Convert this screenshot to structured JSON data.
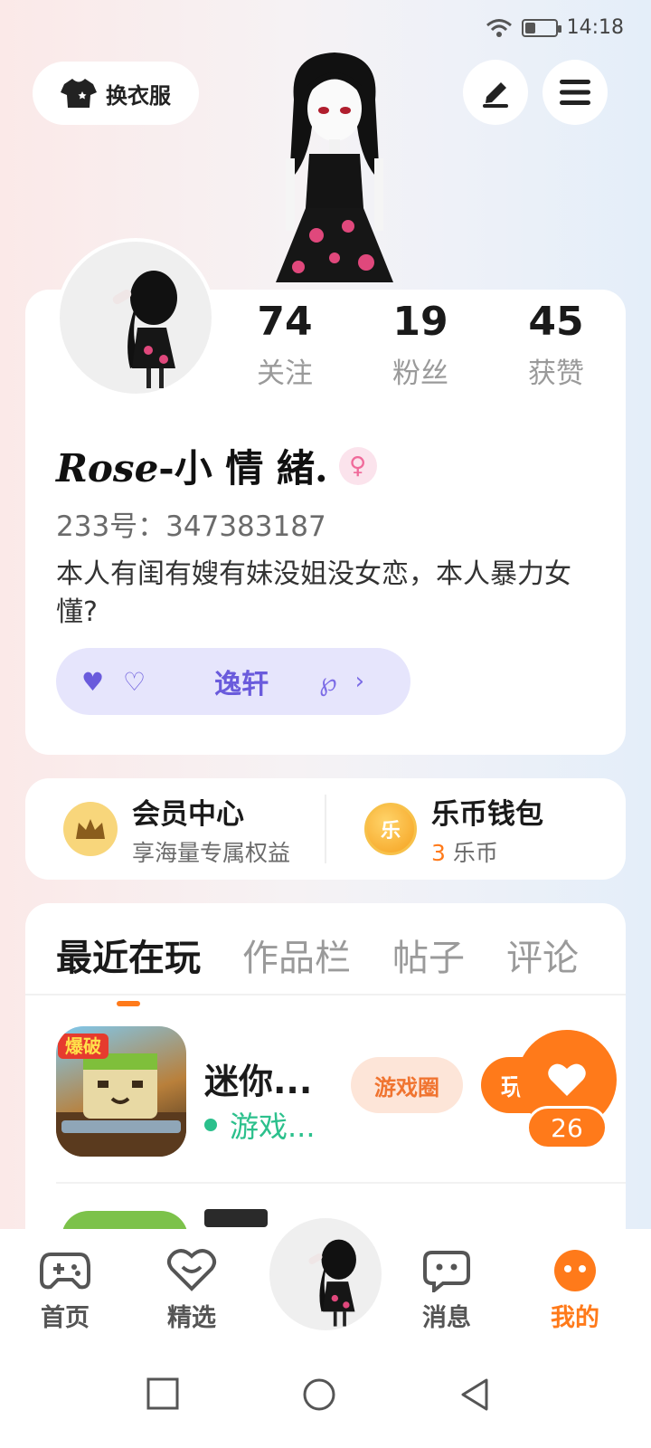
{
  "status_bar": {
    "time": "14:18",
    "battery_level": 0.35
  },
  "top": {
    "dress_label": "换衣服"
  },
  "profile": {
    "stats": [
      {
        "value": "74",
        "label": "关注"
      },
      {
        "value": "19",
        "label": "粉丝"
      },
      {
        "value": "45",
        "label": "获赞"
      }
    ],
    "name_script": "Rose",
    "name_rest": "-小 情 緒.",
    "id_line": "233号：347383187",
    "bio": "本人有闺有嫂有妹没姐没女恋，本人暴力女懂?",
    "relation": {
      "hearts": "♥ ♡",
      "name": "逸轩",
      "icon": "℘",
      "chevron": "›"
    }
  },
  "member": {
    "title": "会员中心",
    "subtitle": "享海量专属权益"
  },
  "wallet": {
    "title": "乐币钱包",
    "amount": "3",
    "unit": " 乐币",
    "coin_label": "乐"
  },
  "tabs": [
    {
      "label": "最近在玩",
      "active": true
    },
    {
      "label": "作品栏",
      "active": false
    },
    {
      "label": "帖子",
      "active": false
    },
    {
      "label": "评论",
      "active": false
    }
  ],
  "game": {
    "name": "迷你...",
    "status": "游戏...",
    "circle_button": "游戏圈",
    "play_button": "玩",
    "banner": "爆破"
  },
  "likes": {
    "count": "26"
  },
  "nav": [
    {
      "label": "首页",
      "icon": "gamepad-icon"
    },
    {
      "label": "精选",
      "icon": "heart-badge-icon"
    },
    {
      "label": "消息",
      "icon": "chat-icon"
    },
    {
      "label": "我的",
      "icon": "face-icon",
      "active": true
    }
  ],
  "colors": {
    "accent": "#ff7a1a",
    "relation": "#6a5bdc",
    "online": "#2bc08c"
  }
}
